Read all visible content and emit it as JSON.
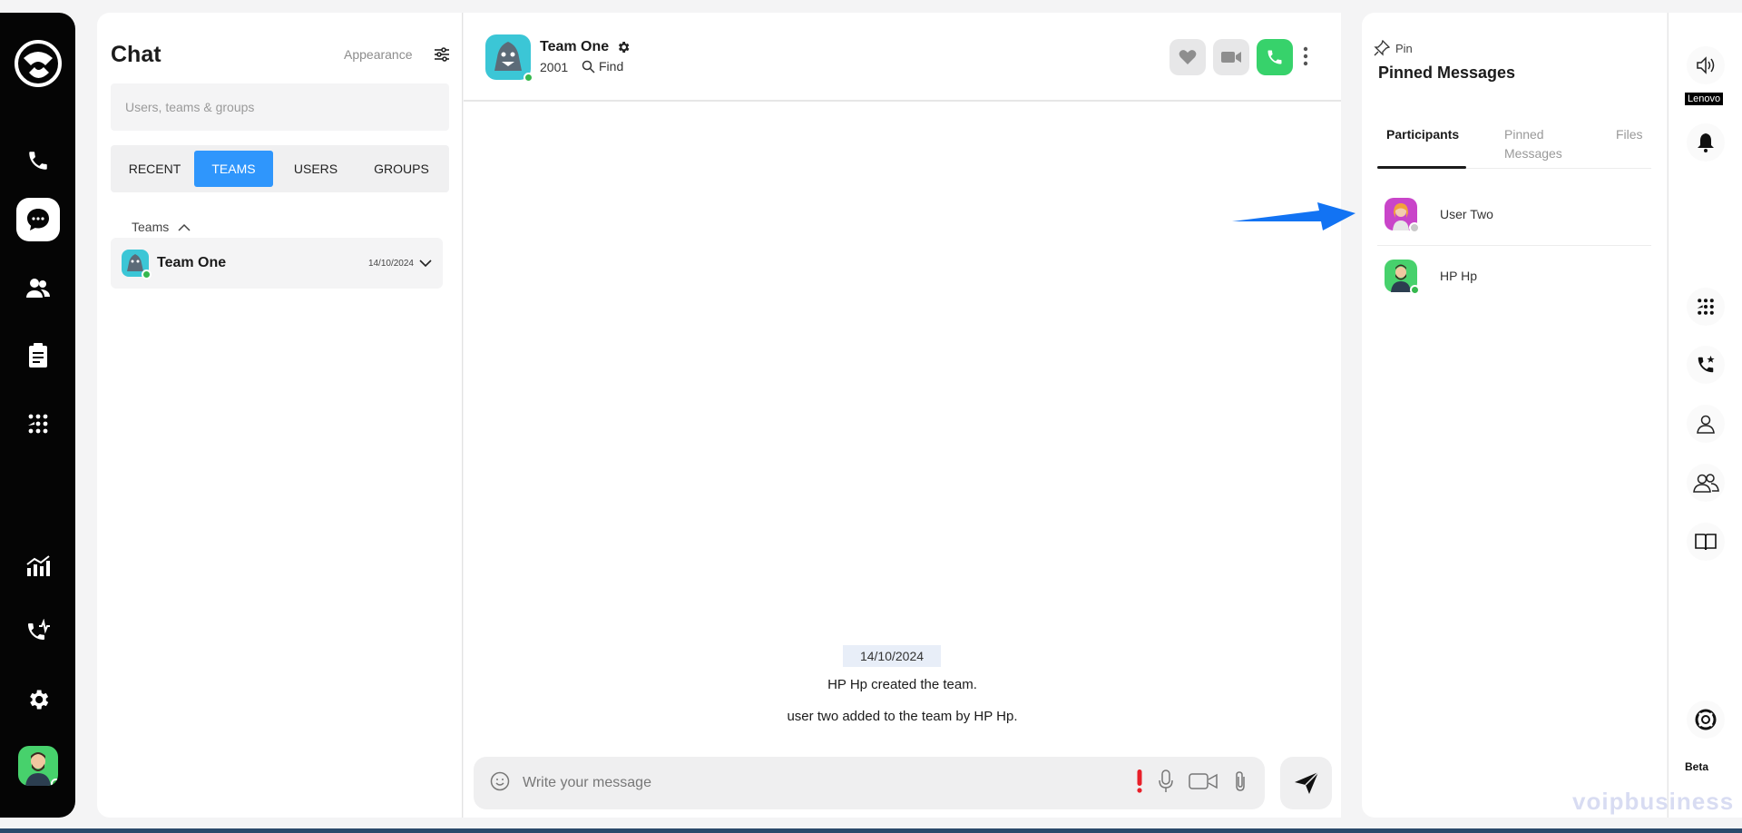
{
  "chat_list": {
    "title": "Chat",
    "appearance_label": "Appearance",
    "search_placeholder": "Users, teams & groups",
    "tabs": [
      "RECENT",
      "TEAMS",
      "USERS",
      "GROUPS"
    ],
    "active_tab": "TEAMS",
    "section_label": "Teams",
    "teams": [
      {
        "name": "Team One",
        "date": "14/10/2024"
      }
    ]
  },
  "conversation": {
    "name": "Team One",
    "extension": "2001",
    "find_label": "Find",
    "date_chip": "14/10/2024",
    "system_messages": [
      "HP Hp created the team.",
      "user two added to the team by HP Hp."
    ],
    "composer_placeholder": "Write your message"
  },
  "right_panel": {
    "pin_label": "Pin",
    "title": "Pinned Messages",
    "tabs": [
      "Participants",
      "Pinned Messages",
      "Files"
    ],
    "active_tab": "Participants",
    "participants": [
      {
        "name": "User Two",
        "status": "away"
      },
      {
        "name": "HP Hp",
        "status": "online"
      }
    ]
  },
  "side_tools": {
    "device_label": "Lenovo",
    "beta_label": "Beta",
    "watermark": "voipbusiness"
  },
  "colors": {
    "accent": "#2f96fc",
    "call_green": "#37d26b",
    "online": "#35b84e",
    "arrow": "#1273f3"
  }
}
